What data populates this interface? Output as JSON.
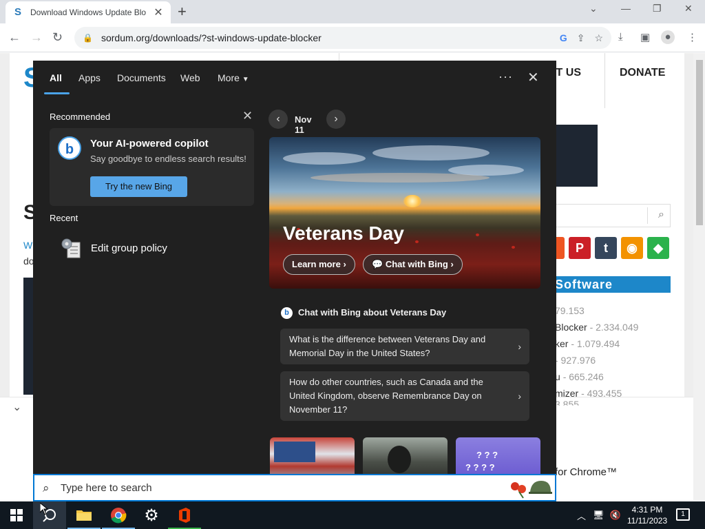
{
  "browser": {
    "tab_title": "Download Windows Update Blo",
    "url": "sordum.org/downloads/?st-windows-update-blocker"
  },
  "website": {
    "nav_contact": "CT US",
    "nav_donate": "DONATE",
    "sidebar_heading": "Software",
    "left_letter": "S",
    "left_text_1": "Wi",
    "left_text_2": "do",
    "software_list": [
      {
        "name": "",
        "count": "79.153"
      },
      {
        "name": "Blocker",
        "count": "- 2.334.049"
      },
      {
        "name": "ker",
        "count": "- 1.079.494"
      },
      {
        "name": "",
        "count": "- 927.976"
      },
      {
        "name": "u",
        "count": "- 665.246"
      },
      {
        "name": "mizer",
        "count": "- 493.455"
      },
      {
        "name": "",
        "count": "3.855"
      }
    ],
    "chrome_text": "for Chrome™"
  },
  "search_flyout": {
    "tabs": [
      "All",
      "Apps",
      "Documents",
      "Web",
      "More"
    ],
    "recommended_title": "Recommended",
    "copilot": {
      "heading": "Your AI-powered copilot",
      "subtitle": "Say goodbye to endless search results!",
      "button": "Try the new Bing"
    },
    "recent_title": "Recent",
    "recent_items": [
      "Edit group policy"
    ],
    "date": "Nov 11",
    "hero": {
      "title": "Veterans Day",
      "learn_more": "Learn more",
      "chat_with_bing": "Chat with Bing"
    },
    "chat_heading": "Chat with Bing about Veterans Day",
    "questions": [
      "What is the difference between Veterans Day and Memorial Day in the United States?",
      "How do other countries, such as Canada and the United Kingdom, observe Remembrance Day on November 11?"
    ]
  },
  "search_box": {
    "placeholder": "Type here to search"
  },
  "taskbar": {
    "time": "4:31 PM",
    "date": "11/11/2023",
    "notification_count": "1"
  },
  "colors": {
    "accent": "#0078d4",
    "flyout_bg": "#202020",
    "taskbar_bg": "#101820",
    "bing_button": "#58a6e8",
    "sidebar_head": "#1d87c9"
  }
}
